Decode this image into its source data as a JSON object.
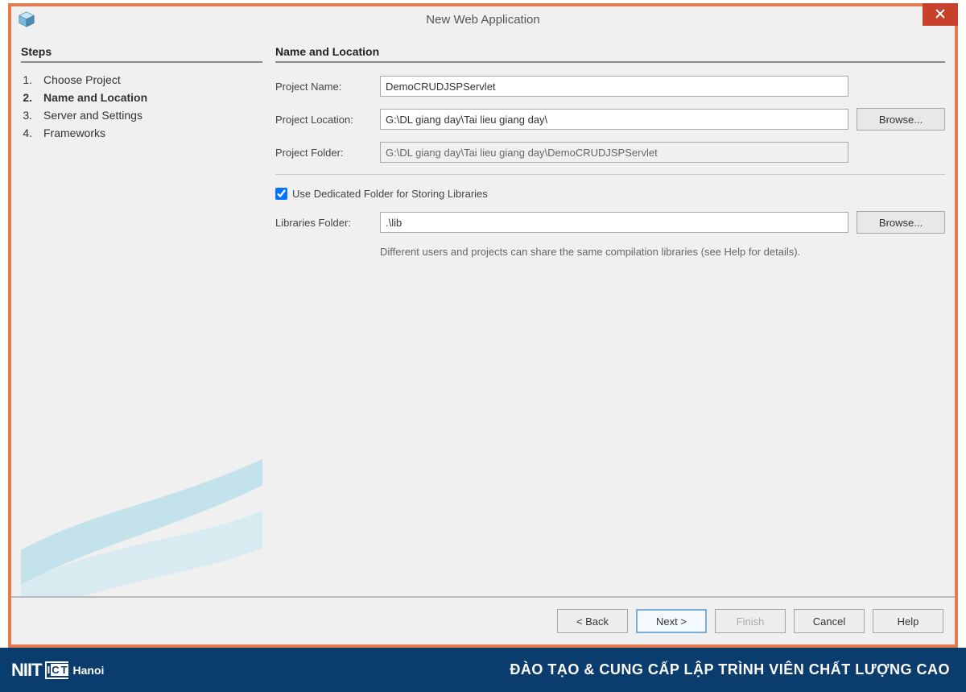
{
  "window": {
    "title": "New Web Application"
  },
  "steps": {
    "heading": "Steps",
    "items": [
      {
        "num": "1.",
        "label": "Choose Project",
        "active": false
      },
      {
        "num": "2.",
        "label": "Name and Location",
        "active": true
      },
      {
        "num": "3.",
        "label": "Server and Settings",
        "active": false
      },
      {
        "num": "4.",
        "label": "Frameworks",
        "active": false
      }
    ]
  },
  "content": {
    "heading": "Name and Location",
    "project_name_label": "Project Name:",
    "project_name_value": "DemoCRUDJSPServlet",
    "project_location_label": "Project Location:",
    "project_location_value": "G:\\DL giang day\\Tai lieu giang day\\",
    "project_folder_label": "Project Folder:",
    "project_folder_value": "G:\\DL giang day\\Tai lieu giang day\\DemoCRUDJSPServlet",
    "browse_label": "Browse...",
    "use_dedicated_label": "Use Dedicated Folder for Storing Libraries",
    "use_dedicated_checked": true,
    "libraries_folder_label": "Libraries Folder:",
    "libraries_folder_value": ".\\lib",
    "hint": "Different users and projects can share the same compilation libraries (see Help for details)."
  },
  "buttons": {
    "back": "< Back",
    "next": "Next >",
    "finish": "Finish",
    "cancel": "Cancel",
    "help": "Help"
  },
  "footer": {
    "brand_niit": "NIIT",
    "brand_ict_i": "I",
    "brand_ict_c": "C",
    "brand_ict_t": "T",
    "brand_hanoi": "Hanoi",
    "slogan": "ĐÀO TẠO & CUNG CẤP LẬP TRÌNH VIÊN CHẤT LƯỢNG CAO"
  }
}
